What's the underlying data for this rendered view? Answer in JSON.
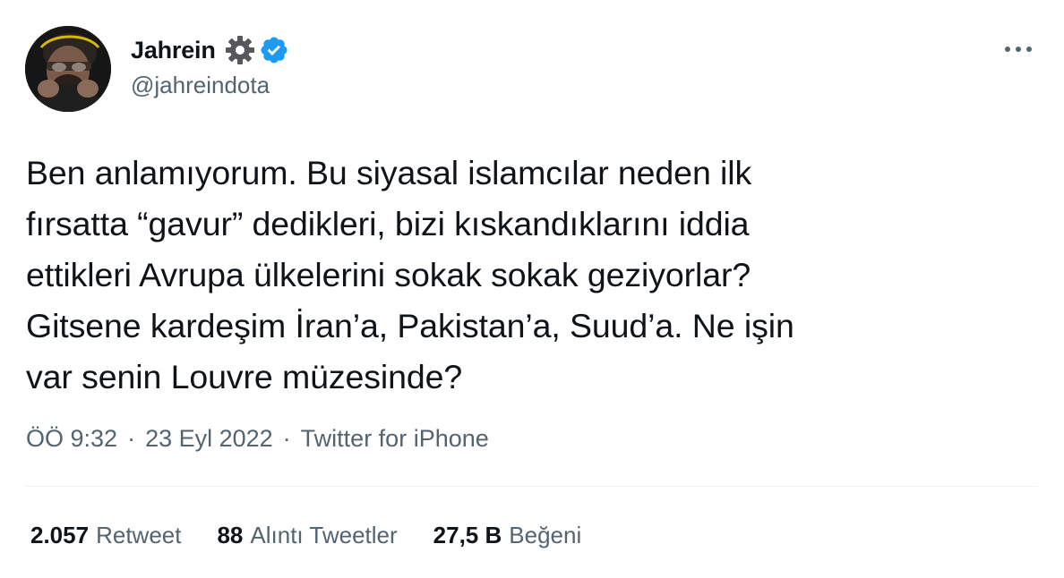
{
  "author": {
    "display_name": "Jahrein",
    "handle": "@jahreindota",
    "verified_color": "#1d9bf0",
    "badge_icons": [
      "gear-icon",
      "verified-badge-icon"
    ]
  },
  "tweet": {
    "text": "Ben anlamıyorum. Bu siyasal islamcılar neden ilk\nfırsatta “gavur” dedikleri, bizi kıskandıklarını iddia\nettikleri Avrupa ülkelerini sokak sokak geziyorlar?\nGitsene kardeşim İran’a, Pakistan’a, Suud’a. Ne işin\nvar senin Louvre müzesinde?",
    "time": "ÖÖ 9:32",
    "date": "23 Eyl 2022",
    "source": "Twitter for iPhone",
    "separator": "·"
  },
  "stats": {
    "retweets_count": "2.057",
    "retweets_label": "Retweet",
    "quotes_count": "88",
    "quotes_label": "Alıntı Tweetler",
    "likes_count": "27,5 B",
    "likes_label": "Beğeni"
  },
  "colors": {
    "text_primary": "#0f1419",
    "text_secondary": "#536471",
    "divider": "#eff3f4",
    "accent": "#1d9bf0"
  }
}
